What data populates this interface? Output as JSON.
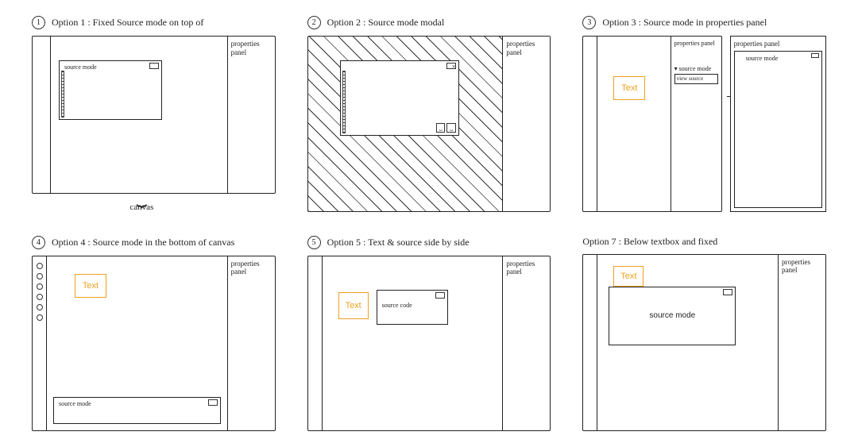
{
  "options": [
    {
      "num": "1",
      "title": "Option 1 : Fixed Source mode on top of",
      "panel_label": "source mode",
      "props_label": "properties panel",
      "canvas_label": "canvas"
    },
    {
      "num": "2",
      "title": "Option 2 : Source mode modal",
      "props_label": "properties panel"
    },
    {
      "num": "3",
      "title": "Option 3 : Source mode in properties panel",
      "text": "Text",
      "props_label": "properties panel",
      "sub1": "▾ source mode",
      "sub2": "view source",
      "detail_props": "properties panel",
      "detail_panel": "source mode"
    },
    {
      "num": "4",
      "title": "Option 4 : Source mode in the bottom of canvas",
      "text": "Text",
      "panel_label": "source mode",
      "props_label": "properties panel"
    },
    {
      "num": "5",
      "title": "Option 5 : Text & source side by side",
      "text": "Text",
      "panel_label": "source code",
      "props_label": "properties panel"
    },
    {
      "num": "7",
      "title": "Option 7 : Below textbox and fixed",
      "text": "Text",
      "panel_label": "source mode",
      "props_label": "properties panel"
    }
  ]
}
